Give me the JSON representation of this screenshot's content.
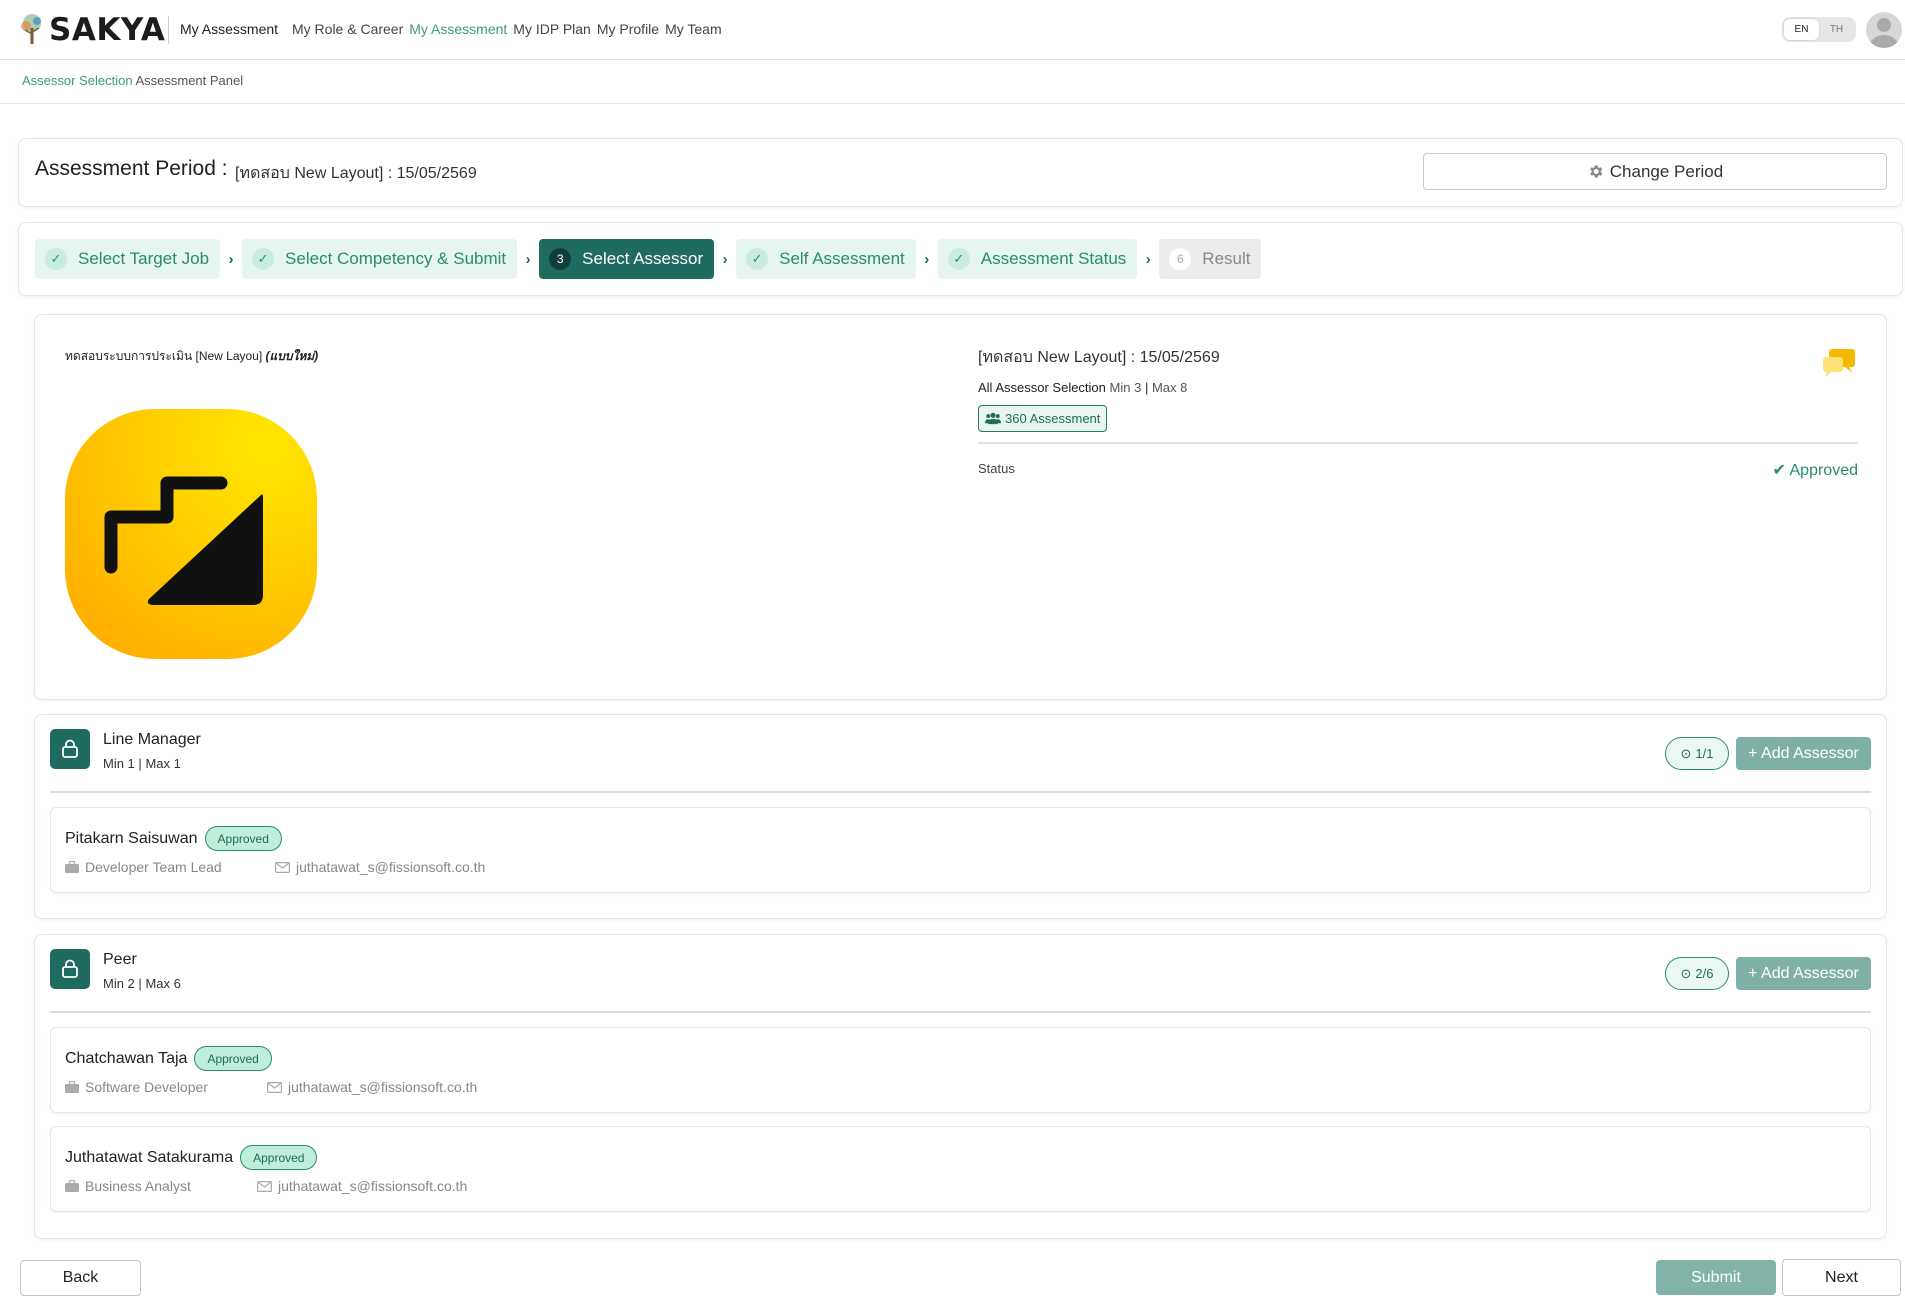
{
  "app": {
    "brand": "SAKYA",
    "current_section": "My Assessment",
    "menu": [
      "My Role & Career",
      "My Assessment",
      "My IDP Plan",
      "My Profile",
      "My Team"
    ],
    "active_menu": "My Assessment",
    "lang": {
      "en": "EN",
      "th": "TH",
      "selected": "EN"
    }
  },
  "breadcrumb": {
    "link": "Assessor Selection",
    "current": "Assessment Panel"
  },
  "period": {
    "label": "Assessment Period :",
    "value": "[ทดสอบ New Layout] : 15/05/2569",
    "change_button": "Change Period"
  },
  "steps": [
    {
      "number": "1",
      "label": "Select Target Job",
      "state": "done"
    },
    {
      "number": "2",
      "label": "Select Competency & Submit",
      "state": "done"
    },
    {
      "number": "3",
      "label": "Select Assessor",
      "state": "active"
    },
    {
      "number": "4",
      "label": "Self Assessment",
      "state": "done"
    },
    {
      "number": "5",
      "label": "Assessment Status",
      "state": "done"
    },
    {
      "number": "6",
      "label": "Result",
      "state": "pending"
    }
  ],
  "info": {
    "small_title": "ทดสอบระบบการประเมิน [New Layou]",
    "small_title_em": "(แบบใหม่)",
    "name": "[ทดสอบ New Layout] : 15/05/2569",
    "selection_label": "All Assessor Selection",
    "min": "Min 3",
    "max": "Max 8",
    "tag": "360 Assessment",
    "status_label": "Status",
    "status_value": "Approved"
  },
  "groups": [
    {
      "title": "Line Manager",
      "min": "Min 1",
      "max": "Max 1",
      "count": "1/1",
      "add_label": "+ Add Assessor",
      "people": [
        {
          "name": "Pitakarn Saisuwan",
          "badge": "Approved",
          "position": "Developer Team Lead",
          "email": "juthatawat_s@fissionsoft.co.th"
        }
      ]
    },
    {
      "title": "Peer",
      "min": "Min 2",
      "max": "Max 6",
      "count": "2/6",
      "add_label": "+ Add Assessor",
      "people": [
        {
          "name": "Chatchawan Taja",
          "badge": "Approved",
          "position": "Software Developer",
          "email": "juthatawat_s@fissionsoft.co.th"
        },
        {
          "name": "Juthatawat Satakurama",
          "badge": "Approved",
          "position": "Business Analyst",
          "email": "juthatawat_s@fissionsoft.co.th"
        }
      ]
    }
  ],
  "footer": {
    "back": "Back",
    "submit": "Submit",
    "next": "Next"
  },
  "colors": {
    "primary": "#1f6b60",
    "accent": "#3c9a86",
    "success": "#2a8a73",
    "disabled_btn": "#82b3a9"
  }
}
